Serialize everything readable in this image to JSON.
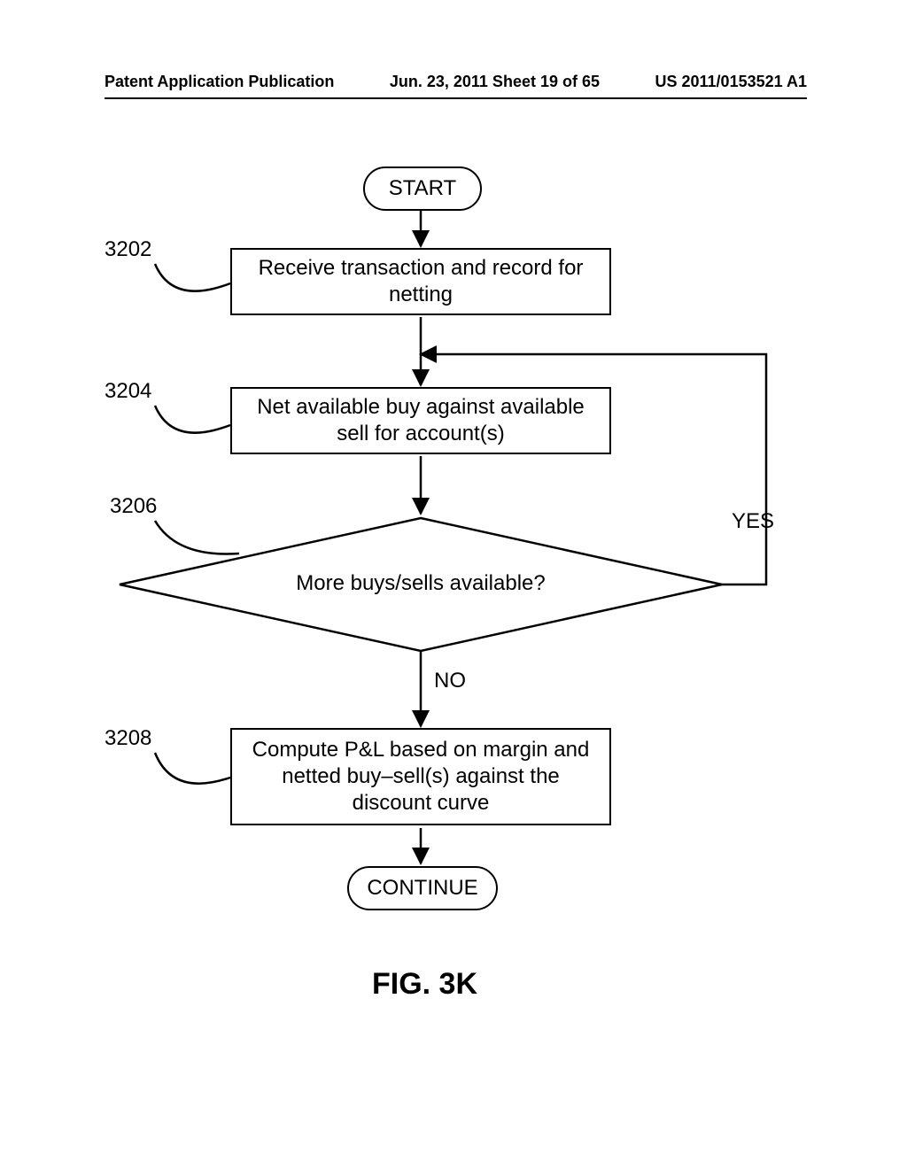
{
  "header": {
    "left": "Patent Application Publication",
    "center": "Jun. 23, 2011  Sheet 19 of 65",
    "right": "US 2011/0153521 A1"
  },
  "flow": {
    "start": "START",
    "continue": "CONTINUE",
    "step3202": {
      "ref": "3202",
      "text": "Receive transaction and record for netting"
    },
    "step3204": {
      "ref": "3204",
      "text": "Net available buy against available sell for account(s)"
    },
    "dec3206": {
      "ref": "3206",
      "text": "More buys/sells available?",
      "yes": "YES",
      "no": "NO"
    },
    "step3208": {
      "ref": "3208",
      "text": "Compute P&L based on margin and netted buy–sell(s) against the discount curve"
    }
  },
  "figure_caption": "FIG. 3K"
}
